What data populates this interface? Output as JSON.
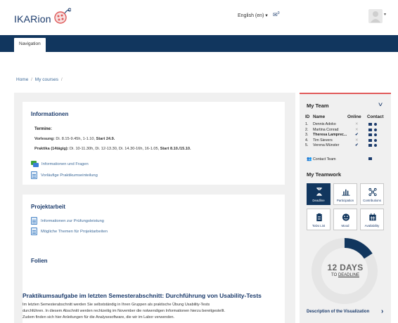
{
  "header": {
    "logo_text": "IKARion",
    "language": "English (en) ▾",
    "messages_badge": "0",
    "user_caret": "▾"
  },
  "navbar": {
    "tab_label": "Navigation"
  },
  "breadcrumb": {
    "home": "Home",
    "sep": "/",
    "courses": "My courses"
  },
  "informationen": {
    "title": "Informationen",
    "termine": "Termine:",
    "vorlesung_label": "Vorlesung:",
    "vorlesung_text": " Di. 8.15-9.45h, 1-1.10, ",
    "vorlesung_start": "Start 24.9.",
    "praktika_label": "Praktika (14tägig):",
    "praktika_text": " Di. 10-11.30h, Di. 12-13.30, Di. 14.30-16h, 16-1.05, ",
    "praktika_start": "Start 8.10./15.10.",
    "links": [
      "Informationen und Fragen",
      "Vorläufige Praktikumseinteilung"
    ]
  },
  "projektarbeit": {
    "title": "Projektarbeit",
    "links": [
      "Informationen zur Prüfungsleistung",
      "Mögliche Themen für Projektarbeiten"
    ]
  },
  "folien": {
    "title": "Folien"
  },
  "praktikum": {
    "title": "Praktikumsaufgabe im letzten Semesterabschnitt: Durchführung von Usability-Tests",
    "lines": [
      "Im letzten Semesterabschnitt werden Sie selbstständig in Ihren Gruppen als praktische Übung Usability-Tests",
      "durchführen. In diesem Abschnitt werden rechtzeitig im November die notwendigen Informationen hierzu bereitgestellt.",
      "Zudem finden sich hier Anleitungen für die Analysesoftware, die wir im Labor verwenden."
    ]
  },
  "my_team": {
    "title": "My Team",
    "headers": {
      "id": "ID",
      "name": "Name",
      "online": "Online",
      "contact": "Contact"
    },
    "members": [
      {
        "id": "1.",
        "name": "Dennis Adoko",
        "online": "✕",
        "online_state": "offline",
        "bold": false
      },
      {
        "id": "2.",
        "name": "Martina Conrad",
        "online": "✕",
        "online_state": "offline",
        "bold": false
      },
      {
        "id": "3.",
        "name": "Theresa Lamprec...",
        "online": "✔",
        "online_state": "online",
        "bold": true
      },
      {
        "id": "4.",
        "name": "Tim Sievers",
        "online": "✕",
        "online_state": "offline",
        "bold": false
      },
      {
        "id": "5.",
        "name": "Verena Münster",
        "online": "✔",
        "online_state": "online",
        "bold": false
      }
    ],
    "contact_team": "Contact Team"
  },
  "my_teamwork": {
    "title": "My Teamwork",
    "tiles": [
      {
        "label": "Deadline",
        "icon": "hourglass-icon",
        "active": true
      },
      {
        "label": "Participation",
        "icon": "bar-chart-icon",
        "active": false
      },
      {
        "label": "Contributions",
        "icon": "network-icon",
        "active": false
      },
      {
        "label": "ToDo List",
        "icon": "clipboard-icon",
        "active": false
      },
      {
        "label": "Mood",
        "icon": "smiley-icon",
        "active": false
      },
      {
        "label": "Availability",
        "icon": "calendar-icon",
        "active": false
      }
    ],
    "deadline_days": "12 DAYS",
    "deadline_to": "TO ",
    "deadline_word": "DEADLINE",
    "deadline_progress": 0.16,
    "description_link": "Description of the Visualization",
    "arrow": "›"
  },
  "colors": {
    "navy": "#11365e",
    "link": "#3d6a99",
    "accent_red": "#e05a5a",
    "panel_gray": "#f0f0f0"
  }
}
